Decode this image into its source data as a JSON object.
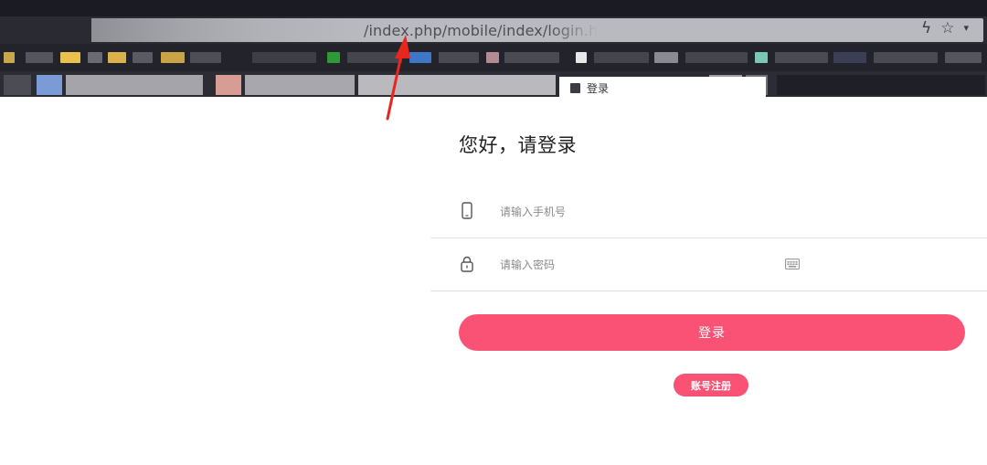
{
  "browser": {
    "url_visible": "/index.php/mobile/index/login.h",
    "icons": [
      "bolt-icon",
      "star-icon",
      "dropdown-icon"
    ],
    "active_tab_label": "登录"
  },
  "login": {
    "greeting": "您好，请登录",
    "phone_placeholder": "请输入手机号",
    "password_placeholder": "请输入密码",
    "login_label": "登录",
    "register_label": "账号注册"
  },
  "colors": {
    "accent": "#f95275",
    "annotation_arrow": "#e8261e"
  }
}
